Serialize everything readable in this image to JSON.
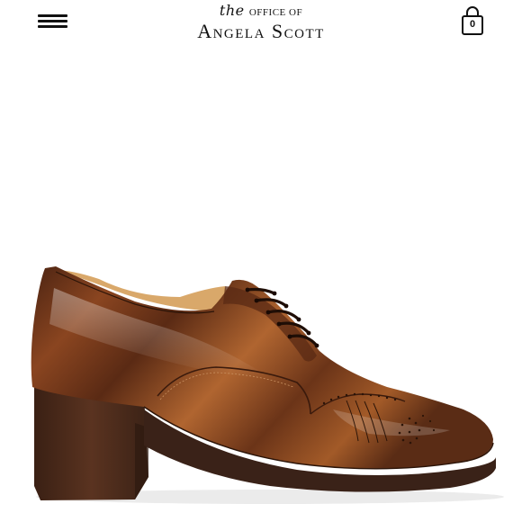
{
  "header": {
    "logo_prefix": "the",
    "logo_top": "OFFICE OF",
    "logo_main": "Angela Scott",
    "cart_count": "0",
    "menu_icon": "hamburger-menu-icon",
    "cart_icon": "shopping-bag-icon"
  },
  "product": {
    "image_subject": "brown brogue oxford heeled shoe",
    "colors": {
      "leather": "#6b3418",
      "leather_highlight": "#b06530",
      "heel": "#4a2a1a",
      "sole": "#3a2218",
      "lining": "#d9a86a"
    }
  }
}
